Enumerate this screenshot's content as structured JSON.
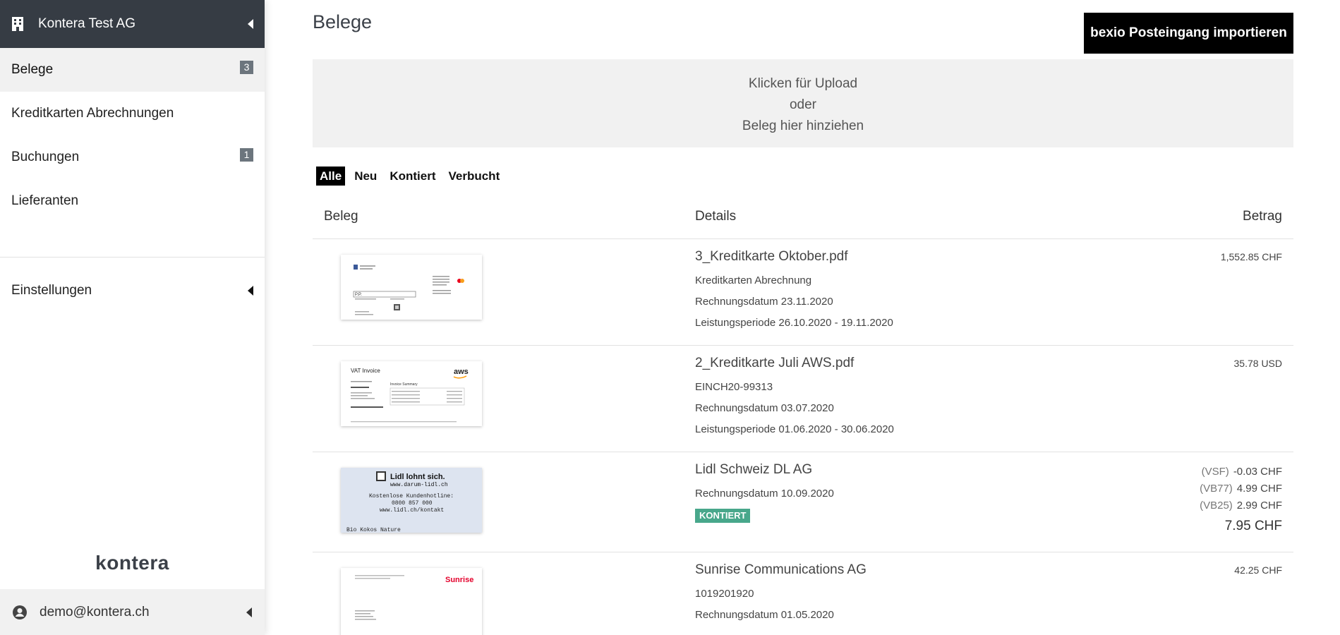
{
  "sidebar": {
    "org_name": "Kontera Test AG",
    "items": [
      {
        "label": "Belege",
        "badge": "3"
      },
      {
        "label": "Kreditkarten Abrechnungen",
        "badge": ""
      },
      {
        "label": "Buchungen",
        "badge": "1"
      },
      {
        "label": "Lieferanten",
        "badge": ""
      }
    ],
    "settings_label": "Einstellungen",
    "brand": "kontera",
    "user_email": "demo@kontera.ch"
  },
  "main": {
    "title": "Belege",
    "import_button": "bexio Posteingang importieren",
    "upload": {
      "line1": "Klicken für Upload",
      "line2": "oder",
      "line3": "Beleg hier hinziehen"
    },
    "filters": [
      "Alle",
      "Neu",
      "Kontiert",
      "Verbucht"
    ],
    "active_filter": "Alle",
    "columns": {
      "beleg": "Beleg",
      "details": "Details",
      "betrag": "Betrag"
    },
    "rows": [
      {
        "filename": "3_Kreditkarte Oktober.pdf",
        "lines": [
          "Kreditkarten Abrechnung",
          "Rechnungsdatum 23.11.2020",
          "Leistungsperiode 26.10.2020 - 19.11.2020"
        ],
        "amount": "1,552.85 CHF"
      },
      {
        "filename": "2_Kreditkarte Juli AWS.pdf",
        "lines": [
          "EINCH20-99313",
          "Rechnungsdatum 03.07.2020",
          "Leistungsperiode 01.06.2020 - 30.06.2020"
        ],
        "amount": "35.78 USD"
      },
      {
        "filename": "Lidl Schweiz DL AG",
        "lines": [
          "Rechnungsdatum 10.09.2020"
        ],
        "status": "KONTIERT",
        "vat": [
          {
            "code": "(VSF)",
            "amount": "-0.03 CHF"
          },
          {
            "code": "(VB77)",
            "amount": "4.99 CHF"
          },
          {
            "code": "(VB25)",
            "amount": "2.99 CHF"
          }
        ],
        "total": "7.95 CHF"
      },
      {
        "filename": "Sunrise Communications AG",
        "lines": [
          "1019201920",
          "Rechnungsdatum 01.05.2020"
        ],
        "amount": "42.25 CHF"
      }
    ]
  },
  "thumbs": {
    "aws_title": "VAT Invoice",
    "aws_logo": "aws",
    "aws_summary": "Invoice Summary",
    "lidl_line1": "Lidl lohnt sich.",
    "lidl_line2": "www.darum-lidl.ch",
    "lidl_line3": "Kostenlose Kundenhotline:",
    "lidl_line4": "0800 857 000",
    "lidl_line5": "www.lidl.ch/kontakt",
    "lidl_line6": "Bio Kokos Nature",
    "sunrise_logo": "Sunrise"
  },
  "colors": {
    "sidebar_header": "#363c44",
    "status_green": "#48a78b",
    "badge": "#6c757d"
  },
  "icons": [
    "building-icon",
    "collapse-left-icon",
    "user-circle-icon"
  ]
}
